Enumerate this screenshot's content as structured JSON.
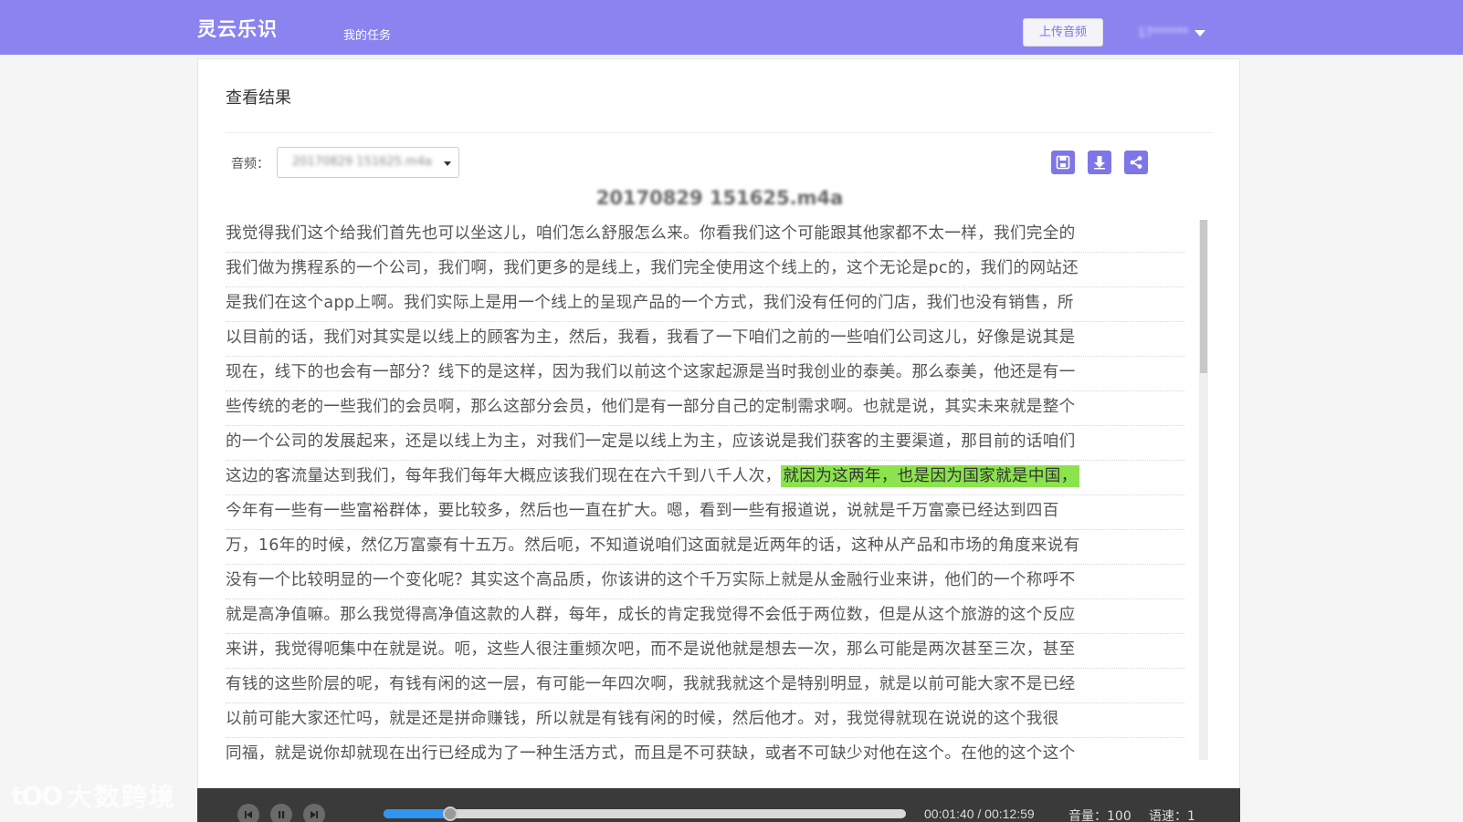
{
  "header": {
    "brand": "灵云乐识",
    "nav_tasks": "我的任务",
    "upload_label": "上传音频",
    "user_name": "17******"
  },
  "card": {
    "title": "查看结果",
    "audio_label": "音频：",
    "audio_selected": "20170829 151625.m4a",
    "file_name": "20170829 151625.m4a"
  },
  "icons": {
    "save": "save-icon",
    "download": "download-icon",
    "share": "share-icon"
  },
  "transcript": {
    "lines": [
      "我觉得我们这个给我们首先也可以坐这儿，咱们怎么舒服怎么来。你看我们这个可能跟其他家都不太一样，我们完全的",
      "我们做为携程系的一个公司，我们啊，我们更多的是线上，我们完全使用这个线上的，这个无论是pc的，我们的网站还",
      "是我们在这个app上啊。我们实际上是用一个线上的呈现产品的一个方式，我们没有任何的门店，我们也没有销售，所",
      "以目前的话，我们对其实是以线上的顾客为主，然后，我看，我看了一下咱们之前的一些咱们公司这儿，好像是说其是",
      "现在，线下的也会有一部分？线下的是这样，因为我们以前这个这家起源是当时我创业的泰美。那么泰美，他还是有一",
      "些传统的老的一些我们的会员啊，那么这部分会员，他们是有一部分自己的定制需求啊。也就是说，其实未来就是整个",
      "的一个公司的发展起来，还是以线上为主，对我们一定是以线上为主，应该说是我们获客的主要渠道，那目前的话咱们"
    ],
    "line8_before": "这边的客流量达到我们，每年我们每年大概应该我们现在在六千到八千人次，",
    "line8_highlight": "就因为这两年，也是因为国家就是中国，",
    "lines_after": [
      "今年有一些有一些富裕群体，要比较多，然后也一直在扩大。嗯，看到一些有报道说，说就是千万富豪已经达到四百",
      "万，16年的时候，然亿万富豪有十五万。然后呃，不知道说咱们这面就是近两年的话，这种从产品和市场的角度来说有",
      "没有一个比较明显的一个变化呢？其实这个高品质，你该讲的这个千万实际上就是从金融行业来讲，他们的一个称呼不",
      "就是高净值嘛。那么我觉得高净值这款的人群，每年，成长的肯定我觉得不会低于两位数，但是从这个旅游的这个反应",
      "来讲，我觉得呃集中在就是说。呃，这些人很注重频次吧，而不是说他就是想去一次，那么可能是两次甚至三次，甚至",
      "有钱的这些阶层的呢，有钱有闲的这一层，有可能一年四次啊，我就我就这个是特别明显，就是以前可能大家不是已经",
      "以前可能大家还忙吗，就是还是拼命赚钱，所以就是有钱有闲的时候，然后他才。对，我觉得就现在说说的这个我很",
      "同福，就是说你却就现在出行已经成为了一种生活方式，而且是不可获缺，或者不可缺少对他在这个。在他的这个这个"
    ],
    "highlight_color": "#8be34d"
  },
  "player": {
    "time": "00:01:40 / 00:12:59",
    "volume": "音量：100",
    "speed": "语速：1",
    "progress": 0.128
  },
  "watermark": {
    "logo": "tOO",
    "text": "大数跨境"
  },
  "colors": {
    "accent": "#8a83f0",
    "button": "#7e76e8",
    "progress": "#2f95f2"
  }
}
